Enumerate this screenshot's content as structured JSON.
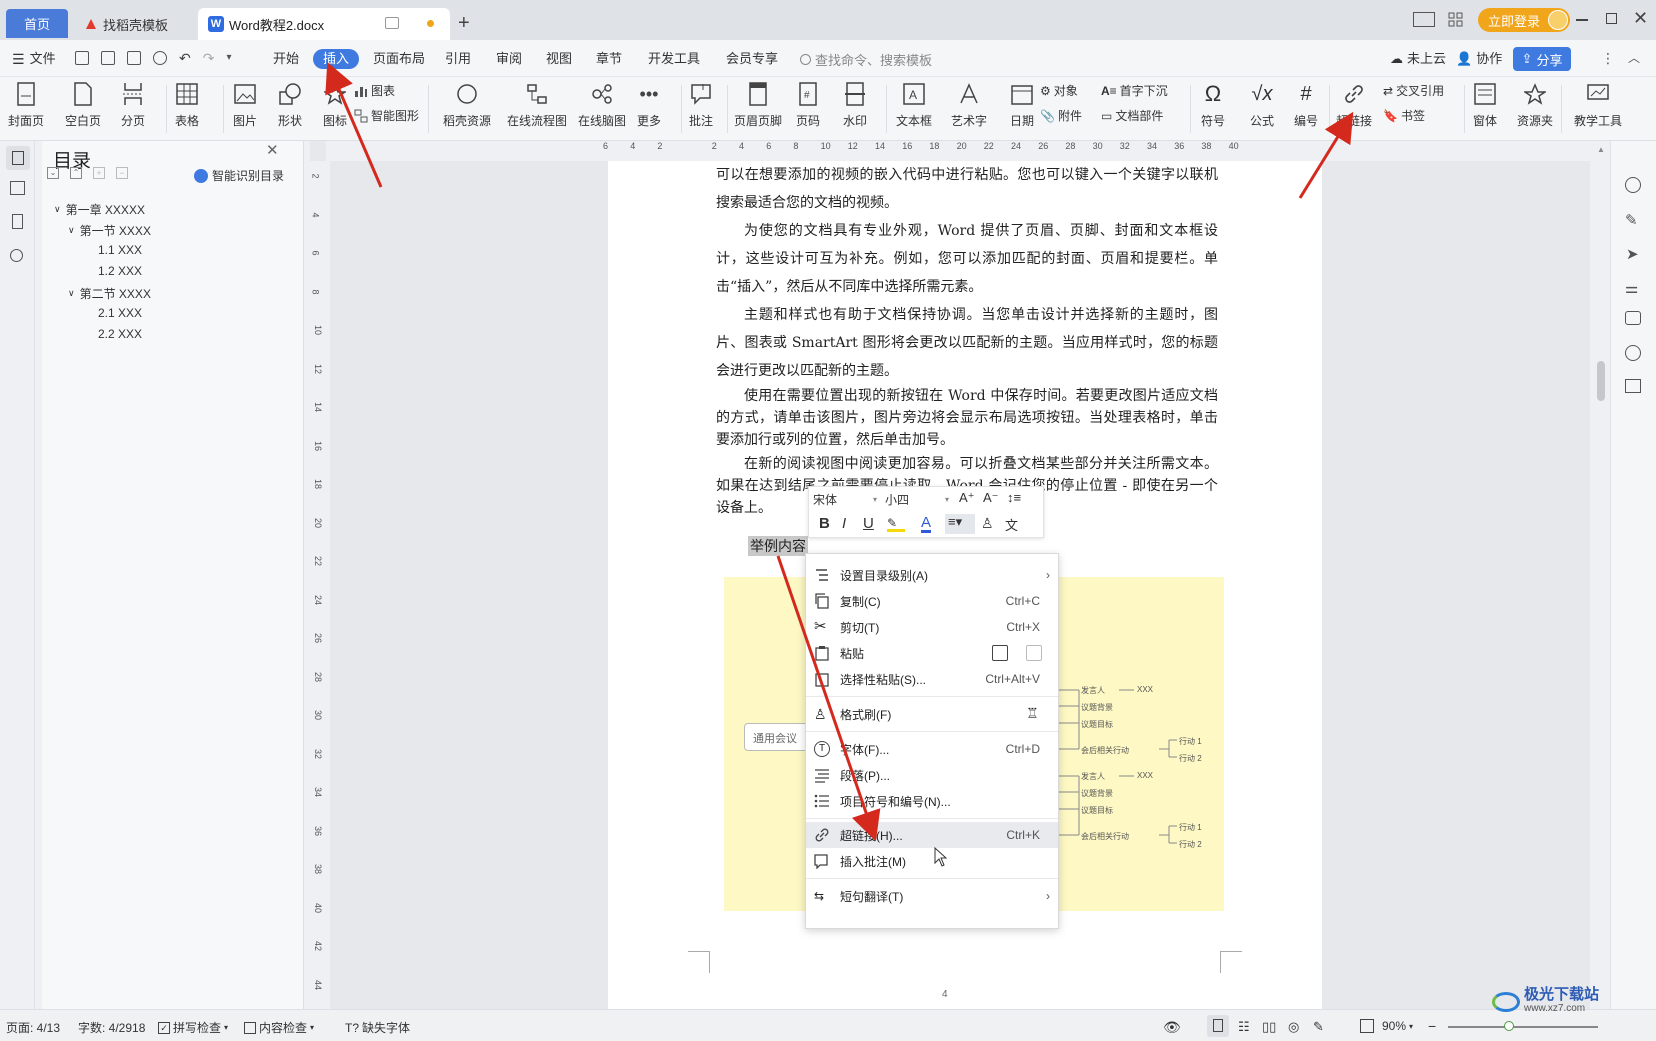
{
  "titlebar": {
    "tabs": [
      {
        "label": "首页"
      },
      {
        "label": "找稻壳模板"
      },
      {
        "label": "Word教程2.docx"
      }
    ],
    "login_label": "立即登录"
  },
  "menubar": {
    "file": "文件",
    "items": [
      "开始",
      "插入",
      "页面布局",
      "引用",
      "审阅",
      "视图",
      "章节",
      "开发工具",
      "会员专享"
    ],
    "search_placeholder": "查找命令、搜索模板",
    "cloud": "未上云",
    "collab": "协作",
    "share": "分享"
  },
  "ribbon": {
    "cover": "封面页",
    "blank": "空白页",
    "pagebreak": "分页",
    "table": "表格",
    "picture": "图片",
    "shape": "形状",
    "icon": "图标",
    "chart": "图表",
    "smartart": "智能图形",
    "docer": "稻壳资源",
    "flowchart": "在线流程图",
    "mindmap": "在线脑图",
    "more": "更多",
    "comment": "批注",
    "headerfooter": "页眉页脚",
    "pagenum": "页码",
    "watermark": "水印",
    "textbox": "文本框",
    "wordart": "艺术字",
    "date": "日期",
    "object": "对象",
    "attachment": "附件",
    "dropcap": "首字下沉",
    "docparts": "文档部件",
    "symbol": "符号",
    "formula": "公式",
    "numbering": "编号",
    "hyperlink": "超链接",
    "crossref": "交叉引用",
    "bookmark": "书签",
    "window": "窗体",
    "resources": "资源夹",
    "teaching": "教学工具"
  },
  "toc": {
    "title": "目录",
    "smart_label": "智能识别目录",
    "items": [
      {
        "label": "第一章 XXXXX"
      },
      {
        "label": "第一节 XXXX"
      },
      {
        "label": "1.1 XXX"
      },
      {
        "label": "1.2 XXX"
      },
      {
        "label": "第二节 XXXX"
      },
      {
        "label": "2.1 XXX"
      },
      {
        "label": "2.2 XXX"
      }
    ]
  },
  "ruler": {
    "h_ticks": [
      "6",
      "4",
      "2",
      "",
      "2",
      "4",
      "6",
      "8",
      "10",
      "12",
      "14",
      "16",
      "18",
      "20",
      "22",
      "24",
      "26",
      "28",
      "30",
      "32",
      "34",
      "36",
      "38",
      "40"
    ],
    "v_ticks": [
      "2",
      "4",
      "6",
      "8",
      "10",
      "12",
      "14",
      "16",
      "18",
      "20",
      "22",
      "24",
      "26",
      "28",
      "30",
      "32",
      "34",
      "36",
      "38",
      "40",
      "42",
      "44"
    ]
  },
  "document": {
    "paragraphs": [
      "可以在想要添加的视频的嵌入代码中进行粘贴。您也可以键入一个关键字以联机搜索最适合您的文档的视频。",
      "为使您的文档具有专业外观，Word 提供了页眉、页脚、封面和文本框设计，这些设计可互为补充。例如，您可以添加匹配的封面、页眉和提要栏。单击“插入”，然后从不同库中选择所需元素。",
      "主题和样式也有助于文档保持协调。当您单击设计并选择新的主题时，图片、图表或 SmartArt 图形将会更改以匹配新的主题。当应用样式时，您的标题会进行更改以匹配新的主题。",
      "使用在需要位置出现的新按钮在 Word 中保存时间。若要更改图片适应文档的方式，请单击该图片，图片旁边将会显示布局选项按钮。当处理表格时，单击要添加行或列的位置，然后单击加号。",
      "在新的阅读视图中阅读更加容易。可以折叠文档某些部分并关注所需文本。如果在达到结尾之前需要停止读取，Word 会记住您的停止位置 - 即使在另一个设备上。"
    ],
    "selected_text": "举例内容",
    "page_number": "4",
    "mindmap": {
      "center": "通用会议",
      "nodes_a": [
        "发言人",
        "XXX",
        "议题背景",
        "议题目标",
        "会后相关行动",
        "行动 1",
        "行动 2"
      ],
      "nodes_b": [
        "发言人",
        "XXX",
        "议题背景",
        "议题目标",
        "会后相关行动",
        "行动 1",
        "行动 2"
      ],
      "top_label": "接"
    }
  },
  "mini_toolbar": {
    "font": "宋体",
    "size": "小四"
  },
  "context_menu": {
    "items": [
      {
        "label": "设置目录级别(A)",
        "key": ""
      },
      {
        "label": "复制(C)",
        "key": "Ctrl+C"
      },
      {
        "label": "剪切(T)",
        "key": "Ctrl+X"
      },
      {
        "label": "粘贴",
        "key": ""
      },
      {
        "label": "选择性粘贴(S)...",
        "key": "Ctrl+Alt+V"
      },
      {
        "label": "格式刷(F)",
        "key": ""
      },
      {
        "label": "字体(F)...",
        "key": "Ctrl+D"
      },
      {
        "label": "段落(P)...",
        "key": ""
      },
      {
        "label": "项目符号和编号(N)...",
        "key": ""
      },
      {
        "label": "超链接(H)...",
        "key": "Ctrl+K"
      },
      {
        "label": "插入批注(M)",
        "key": ""
      },
      {
        "label": "短句翻译(T)",
        "key": ""
      }
    ]
  },
  "statusbar": {
    "page": "页面: 4/13",
    "words": "字数: 4/2918",
    "spell": "拼写检查",
    "content_check": "内容检查",
    "missing_font": "缺失字体",
    "zoom": "90%"
  },
  "watermark_text": "极光下载站",
  "watermark_url": "www.xz7.com",
  "colors": {
    "accent": "#3f7ae0",
    "login": "#f0a51a",
    "arrow": "#d42a1e",
    "mindmap_bg": "#fdf8c4"
  }
}
